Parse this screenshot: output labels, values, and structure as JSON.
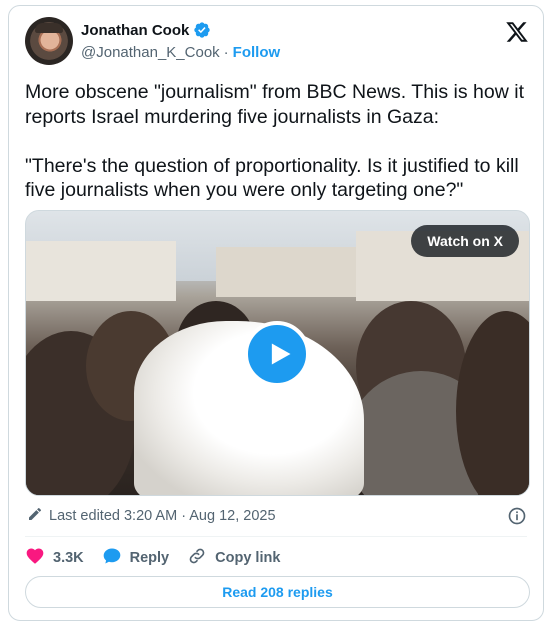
{
  "author": {
    "name": "Jonathan Cook",
    "handle": "@Jonathan_K_Cook",
    "separator": "·",
    "follow_label": "Follow",
    "verified": true
  },
  "tweet": {
    "paragraph_1": "More obscene \"journalism\" from BBC News. This is how it reports Israel murdering five journalists in Gaza:",
    "paragraph_2": "\"There's the question of proportionality. Is it justified to kill five journalists when you were only targeting one?\""
  },
  "media": {
    "watch_label": "Watch on X",
    "play_icon": "play-icon"
  },
  "meta": {
    "edited_text": "Last edited 3:20 AM · Aug 12, 2025"
  },
  "actions": {
    "like_count": "3.3K",
    "reply_label": "Reply",
    "copy_label": "Copy link"
  },
  "footer": {
    "read_replies_label": "Read 208 replies"
  },
  "colors": {
    "accent": "#1d9bf0",
    "like": "#f91880",
    "muted": "#536471",
    "text": "#0f1419",
    "border": "#cfd9de"
  }
}
